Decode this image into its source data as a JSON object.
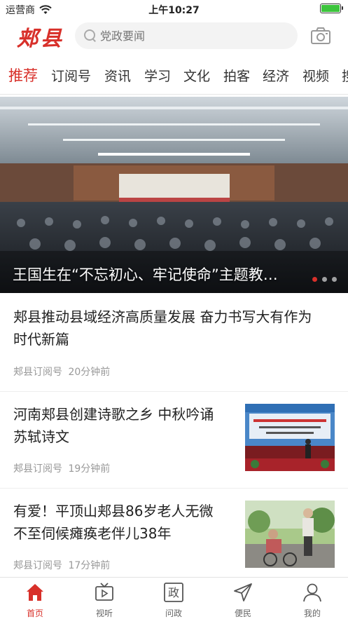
{
  "status_bar": {
    "carrier": "运营商",
    "time": "上午10:27"
  },
  "header": {
    "logo_text": "郏县",
    "search_placeholder": "党政要闻",
    "accent": "#d8302a"
  },
  "tabs": [
    "推荐",
    "订阅号",
    "资讯",
    "学习",
    "文化",
    "拍客",
    "经济",
    "视频",
    "搜"
  ],
  "hero": {
    "caption": "王国生在“不忘初心、牢记使命”主题教…",
    "slide_count": 3,
    "active_slide": 0
  },
  "news": [
    {
      "title_line1": "郏县推动县域经济高质量发展 奋力书写大有作为",
      "title_line2": "时代新篇",
      "source": "郏县订阅号",
      "time": "20分钟前",
      "has_thumb": false
    },
    {
      "title_line1": "河南郏县创建诗歌之乡 中秋吟诵",
      "title_line2": "苏轼诗文",
      "source": "郏县订阅号",
      "time": "19分钟前",
      "has_thumb": true,
      "thumb_icon": "stage-event-thumbnail"
    },
    {
      "title_line1": "有爱！平顶山郏县86岁老人无微",
      "title_line2": "不至伺候瘫痪老伴儿38年",
      "source": "郏县订阅号",
      "time": "17分钟前",
      "has_thumb": true,
      "thumb_icon": "elderly-couple-thumbnail"
    }
  ],
  "bottom_nav": [
    {
      "label": "首页",
      "icon": "home-icon",
      "active": true
    },
    {
      "label": "视听",
      "icon": "tv-icon",
      "active": false
    },
    {
      "label": "问政",
      "icon": "zheng-icon",
      "active": false,
      "glyph": "政"
    },
    {
      "label": "便民",
      "icon": "send-icon",
      "active": false
    },
    {
      "label": "我的",
      "icon": "user-icon",
      "active": false
    }
  ]
}
